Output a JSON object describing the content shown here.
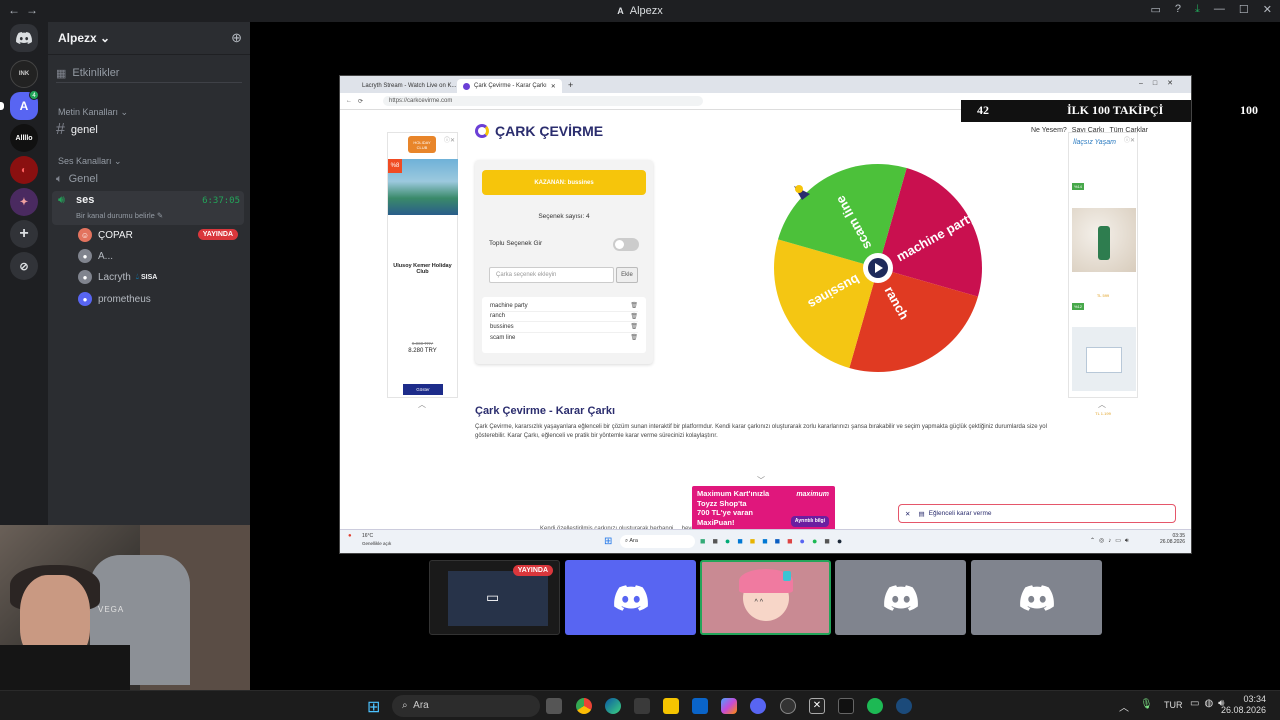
{
  "titlebar": {
    "server_letter": "A",
    "title": "Alpezx"
  },
  "rail": {
    "servers": [
      {
        "label": "",
        "color": "#5865f2",
        "icon": "discord-home-icon"
      },
      {
        "label": "",
        "color": "#222222",
        "icon": "server-icon-1"
      },
      {
        "label": "A",
        "color": "#5865f2",
        "icon": "server-icon-alpezx"
      },
      {
        "label": "Allllo",
        "color": "#111111",
        "icon": "server-icon-3"
      },
      {
        "label": "",
        "color": "#8a1010",
        "icon": "server-icon-4"
      },
      {
        "label": "",
        "color": "#4a2a60",
        "icon": "server-icon-5"
      }
    ],
    "alpezx_badge": "4"
  },
  "channels": {
    "guild_name": "Alpezx",
    "events_label": "Etkinlikler",
    "text_category": "Metin Kanalları",
    "text_channel": "genel",
    "voice_category": "Ses Kanalları",
    "voice_channel_1": "Genel",
    "voice_channel_2": "ses",
    "voice_timer": "6:37:05",
    "voice_status": "Bir kanal durumu belirle",
    "users": [
      {
        "name": "ÇOPAR",
        "live": "YAYINDA",
        "color": "#e3735e"
      },
      {
        "name": "A...",
        "live": "",
        "color": "#80848e"
      },
      {
        "name": "Lacryth",
        "tag": "SISA",
        "live": "",
        "color": "#80848e"
      },
      {
        "name": "prometheus",
        "live": "",
        "color": "#5865f2"
      }
    ]
  },
  "webcam": {
    "chair_brand": "VEGA"
  },
  "browser": {
    "tabs": [
      {
        "label": "Lacryth Stream - Watch Live on K...",
        "fav_color": "#53fc18"
      },
      {
        "label": "Çark Çevirme - Karar Çarkı",
        "fav_color": "#6b3fd6"
      }
    ],
    "url": "https://carkcevirme.com",
    "site_title": "ÇARK ÇEVİRME",
    "nav": [
      "Ne Yesem?",
      "Sayı Çarkı",
      "Tüm Çarklar"
    ],
    "winner_label": "KAZANAN: bussines",
    "option_count": "Seçenek sayısı: 4",
    "bulk_label": "Toplu Seçenek Gir",
    "input_placeholder": "Çarka seçenek ekleyin",
    "add_button": "Ekle",
    "options": [
      "machine party",
      "ranch",
      "bussines",
      "scam line"
    ],
    "wheel_colors": [
      "#c9104f",
      "#e03a22",
      "#f4c613",
      "#4cc13a"
    ],
    "heading": "Çark Çevirme - Karar Çarkı",
    "paragraph": "Çark Çevirme, kararsızlık yaşayanlara eğlenceli bir çözüm sunan interaktif bir platformdur. Kendi karar çarkınızı oluşturarak zorlu kararlarınızı şansa bırakabilir ve seçim yapmakta güçlük çektiğiniz durumlarda size yol gösterebilir. Karar Çarkı, eğlenceli ve pratik bir yöntemle karar verme sürecinizi kolaylaştırır.",
    "tail_text": "Kendi özelleştirilmiş çarkınızı oluşturarak herhangi ... heyecan verici bir deneyim yaşayabilirsiniz.",
    "left_ad": {
      "badge": "%8",
      "brand": "HOLIDAY CLUB",
      "title": "Ulusoy Kemer Holiday Club",
      "old_price": "9.000 TRY",
      "price": "8.280 TRY",
      "button": "Göster"
    },
    "right_ad": {
      "brand": "İlaçsız Yaşam",
      "badge1": "%14",
      "badge2": "%12",
      "price1": "TL 599",
      "price2": "TL 1.199"
    },
    "promo": {
      "line1": "Maximum Kart'ınızla",
      "line2": "Toyzz Shop'ta",
      "line3": "700 TL'ye varan",
      "line4": "MaxiPuan!",
      "brand": "maximum",
      "button": "Ayrıntılı bilgi"
    },
    "toast": "Eğlenceli karar verme",
    "inner_taskbar": {
      "weather": "16°C",
      "weather_sub": "Genellikle açık",
      "search": "Ara",
      "time": "03:35",
      "date": "26.08.2026"
    }
  },
  "overlay": {
    "current": "42",
    "label": "İLK 100 TAKİPÇİ",
    "goal": "100"
  },
  "tiles": {
    "live_badge": "YAYINDA"
  },
  "taskbar": {
    "search": "Ara",
    "lang": "TUR",
    "time": "03:34",
    "date": "26.08.2026"
  }
}
